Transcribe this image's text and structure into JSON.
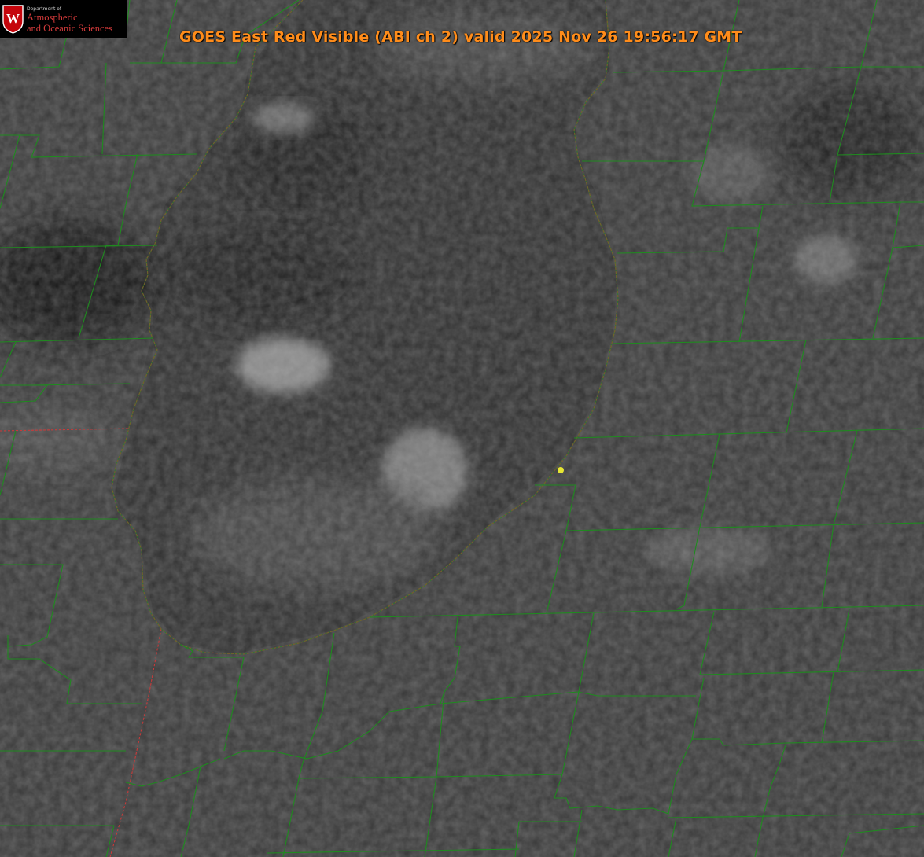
{
  "title": "GOES East Red Visible (ABI ch 2) valid 2025 Nov 26 19:56:17 GMT",
  "logo": {
    "department_line": "Department of",
    "line1": "Atmospheric",
    "line2": "and Oceanic Sciences",
    "seal_letter": "W"
  },
  "colors": {
    "title": "#ff8c1a",
    "county_lines": "#1f8a1f",
    "state_lines": "#c83a3a",
    "marker": "#e6e632",
    "logo_red": "#c5050c"
  },
  "map": {
    "features": [
      "county-boundaries",
      "state-boundaries",
      "lake-shoreline",
      "location-marker"
    ]
  }
}
